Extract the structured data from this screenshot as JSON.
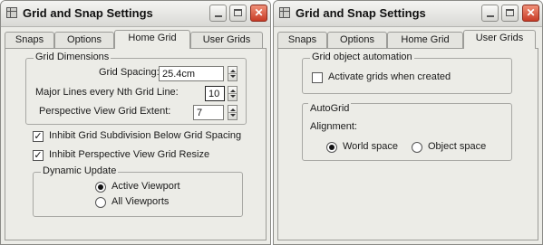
{
  "window_left": {
    "title": "Grid and Snap Settings",
    "tabs": [
      "Snaps",
      "Options",
      "Home Grid",
      "User Grids"
    ],
    "active_tab": "Home Grid",
    "grid_dimensions": {
      "legend": "Grid Dimensions",
      "grid_spacing_label": "Grid Spacing:",
      "grid_spacing_value": "25.4cm",
      "major_lines_label": "Major Lines every Nth Grid Line:",
      "major_lines_value": "10",
      "perspective_extent_label": "Perspective View Grid Extent:",
      "perspective_extent_value": "7"
    },
    "inhibit_subdivision": {
      "label": "Inhibit Grid Subdivision Below Grid Spacing",
      "checked": true
    },
    "inhibit_resize": {
      "label": "Inhibit Perspective View Grid Resize",
      "checked": true
    },
    "dynamic_update": {
      "legend": "Dynamic Update",
      "options": [
        "Active Viewport",
        "All Viewports"
      ],
      "selected": "Active Viewport"
    }
  },
  "window_right": {
    "title": "Grid and Snap Settings",
    "tabs": [
      "Snaps",
      "Options",
      "Home Grid",
      "User Grids"
    ],
    "active_tab": "User Grids",
    "grid_object_automation": {
      "legend": "Grid object automation",
      "activate_label": "Activate grids when created",
      "activate_checked": false
    },
    "autogrid": {
      "legend": "AutoGrid",
      "alignment_label": "Alignment:",
      "options": [
        "World space",
        "Object space"
      ],
      "selected": "World space"
    }
  },
  "titlebar_buttons": {
    "minimize_icon": "minimize-icon",
    "maximize_icon": "maximize-icon",
    "close_icon": "close-icon",
    "close_glyph": "✕"
  },
  "colors": {
    "window_bg": "#ecece7",
    "close_button": "#d04a32"
  }
}
